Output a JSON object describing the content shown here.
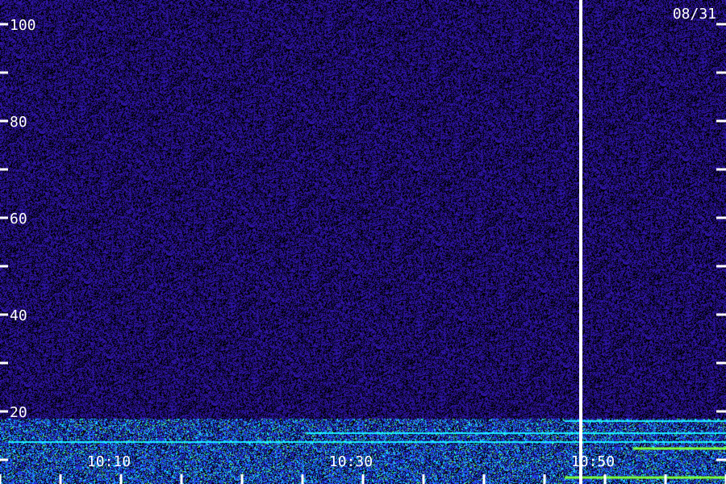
{
  "chart_data": {
    "type": "heatmap",
    "date_label": "08/31",
    "y_axis": {
      "tick_labels": [
        "20",
        "40",
        "60",
        "80",
        "100"
      ],
      "tick_values": [
        20,
        40,
        60,
        80,
        100
      ],
      "minor_tick_values": [
        10,
        30,
        50,
        70,
        90
      ],
      "range": [
        5,
        105
      ]
    },
    "x_axis": {
      "tick_labels": [
        "10:10",
        "10:30",
        "10:50"
      ],
      "tick_times": [
        "10:10",
        "10:30",
        "10:50"
      ],
      "range": [
        "10:01",
        "11:01"
      ]
    },
    "marker_time": "10:49",
    "colors": {
      "background": "#1c0c4a",
      "low": "#2a14a0",
      "mid": "#1f4bff",
      "high": "#19f0ff",
      "peak": "#7dff3a",
      "marker": "#ffffff",
      "text": "#ffffff"
    }
  }
}
